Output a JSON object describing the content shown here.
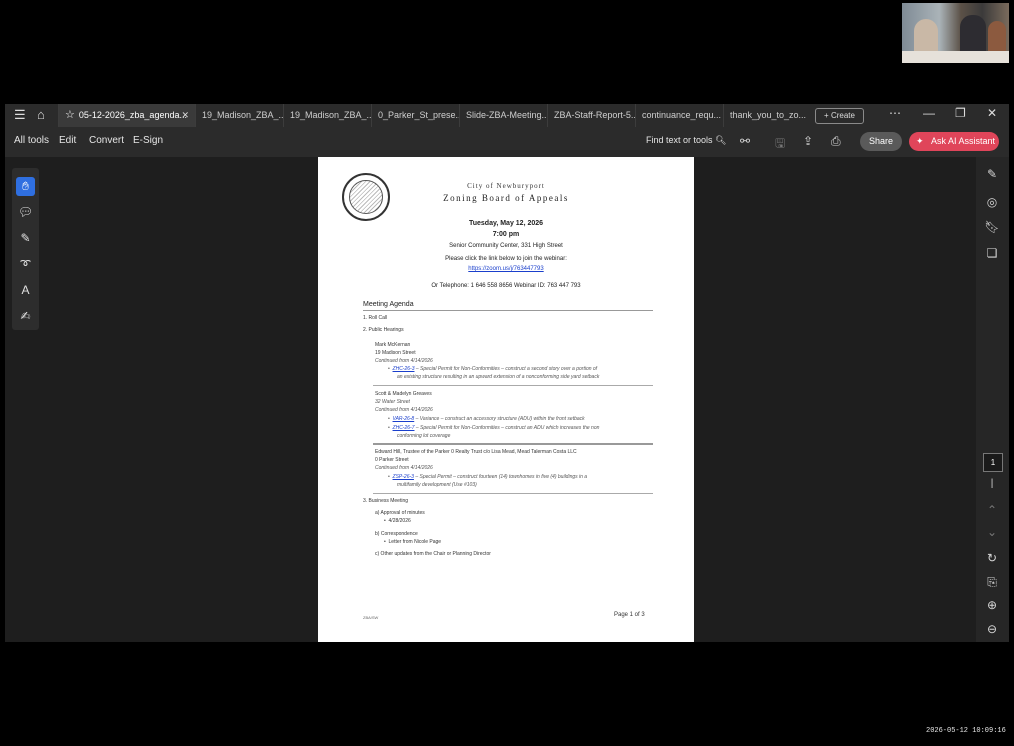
{
  "window": {
    "tabs": [
      {
        "label": "05-12-2026_zba_agenda...",
        "active": true
      },
      {
        "label": "19_Madison_ZBA_..."
      },
      {
        "label": "19_Madison_ZBA_..."
      },
      {
        "label": "0_Parker_St_prese..."
      },
      {
        "label": "Slide-ZBA-Meeting..."
      },
      {
        "label": "ZBA-Staff-Report-5..."
      },
      {
        "label": "continuance_requ..."
      },
      {
        "label": "thank_you_to_zo..."
      }
    ],
    "create_label": "Create",
    "controls": [
      "⋯",
      "—",
      "❐",
      "✕"
    ]
  },
  "toolbar": {
    "menu": [
      "All tools",
      "Edit",
      "Convert",
      "E-Sign"
    ],
    "find_label": "Find text or tools",
    "share_label": "Share",
    "ai_label": "Ask AI Assistant"
  },
  "right_panel": {
    "page_number": "1"
  },
  "document": {
    "city": "City of Newburyport",
    "board": "Zoning Board of Appeals",
    "date": "Tuesday, May 12, 2026",
    "time": "7:00 pm",
    "venue": "Senior Community Center, 331 High Street",
    "click_text": "Please click the link below to join the webinar:",
    "webinar_link": "https://zoom.us/j/763447793",
    "phone": "Or Telephone: 1 646 558 8656 Webinar ID: 763 447 793",
    "agenda_title": "Meeting Agenda",
    "items": {
      "roll_call": "1.   Roll Call",
      "public_hearings": "2.   Public Hearings",
      "h1_applicant": "Mark McKernan",
      "h1_address": "19 Madison Street",
      "h1_continued": "Continued from 4/14/2026",
      "h1_case": "ZHC-26-3",
      "h1_desc_1": " – Special Permit for Non-Conformities – construct a second story over a portion of",
      "h1_desc_2": "an existing structure resulting in an upward extension of a nonconforming side yard setback",
      "h2_applicant": "Scott & Madelyn Greaves",
      "h2_address": "32 Water Street",
      "h2_continued": "Continued from 4/14/2026",
      "h2_case_a": "VAR-26-8",
      "h2_desc_a": " – Variance – construct an accessory structure (ADU) within the front setback",
      "h2_case_b": "ZHC-26-7",
      "h2_desc_b_1": " – Special Permit for Non-Conformities – construct an ADU which increases the non",
      "h2_desc_b_2": "conforming lot coverage",
      "h3_applicant": "Edward Hill, Trustee of the Parker 0 Realty Trust c/o Lisa Mead, Mead Talerman Costa LLC",
      "h3_address": "0 Parker Street",
      "h3_continued": "Continued from 4/14/2026",
      "h3_case": "ZSP-26-3",
      "h3_desc_1": " – Special Permit – construct fourteen (14) townhomes in five (4) buildings in a",
      "h3_desc_2": "multifamily development (Use #103)",
      "business": "3.   Business Meeting",
      "b_a": "a)   Approval of minutes",
      "b_a1": "4/28/2026",
      "b_b": "b)   Correspondence",
      "b_b1": "Letter from Nicole Page",
      "b_c": "c)   Other updates from the Chair or Planning Director"
    },
    "footer_left": "ZBA/SW",
    "footer_right": "Page  1  of  3"
  },
  "timestamp": "2026-05-12  10:09:16"
}
